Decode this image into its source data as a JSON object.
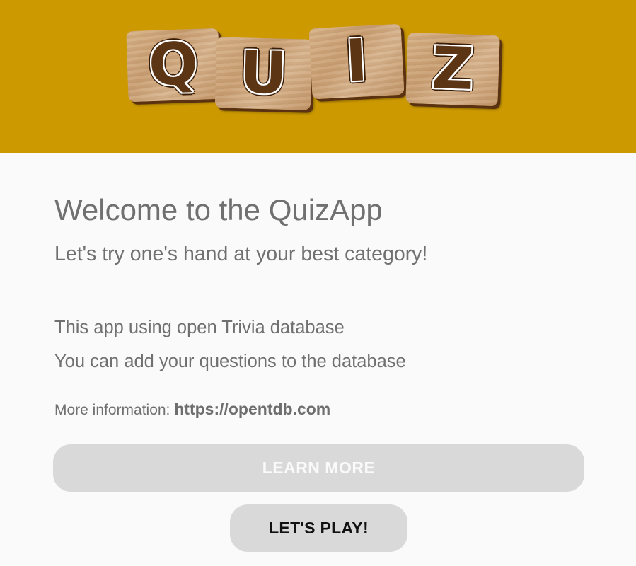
{
  "header": {
    "background_color": "#cc9900",
    "logo": {
      "letters": [
        "Q",
        "U",
        "I",
        "Z"
      ],
      "tile_color": "#d2ab80",
      "letter_color": "#5c3514"
    }
  },
  "content": {
    "title": "Welcome to the QuizApp",
    "subtitle": "Let's try one's hand at your best category!",
    "info_line_1": "This app using open Trivia database",
    "info_line_2": "You can add your questions to the database",
    "more_info_label": "More information: ",
    "more_info_link": "https://opentdb.com",
    "text_color": "#707070"
  },
  "buttons": {
    "learn_more": {
      "label": "LEARN MORE",
      "background_color": "#d8d9d8",
      "text_color": "#fafafa"
    },
    "lets_play": {
      "label": "LET'S PLAY!",
      "background_color": "#d8d9d8",
      "text_color": "#111111"
    }
  }
}
